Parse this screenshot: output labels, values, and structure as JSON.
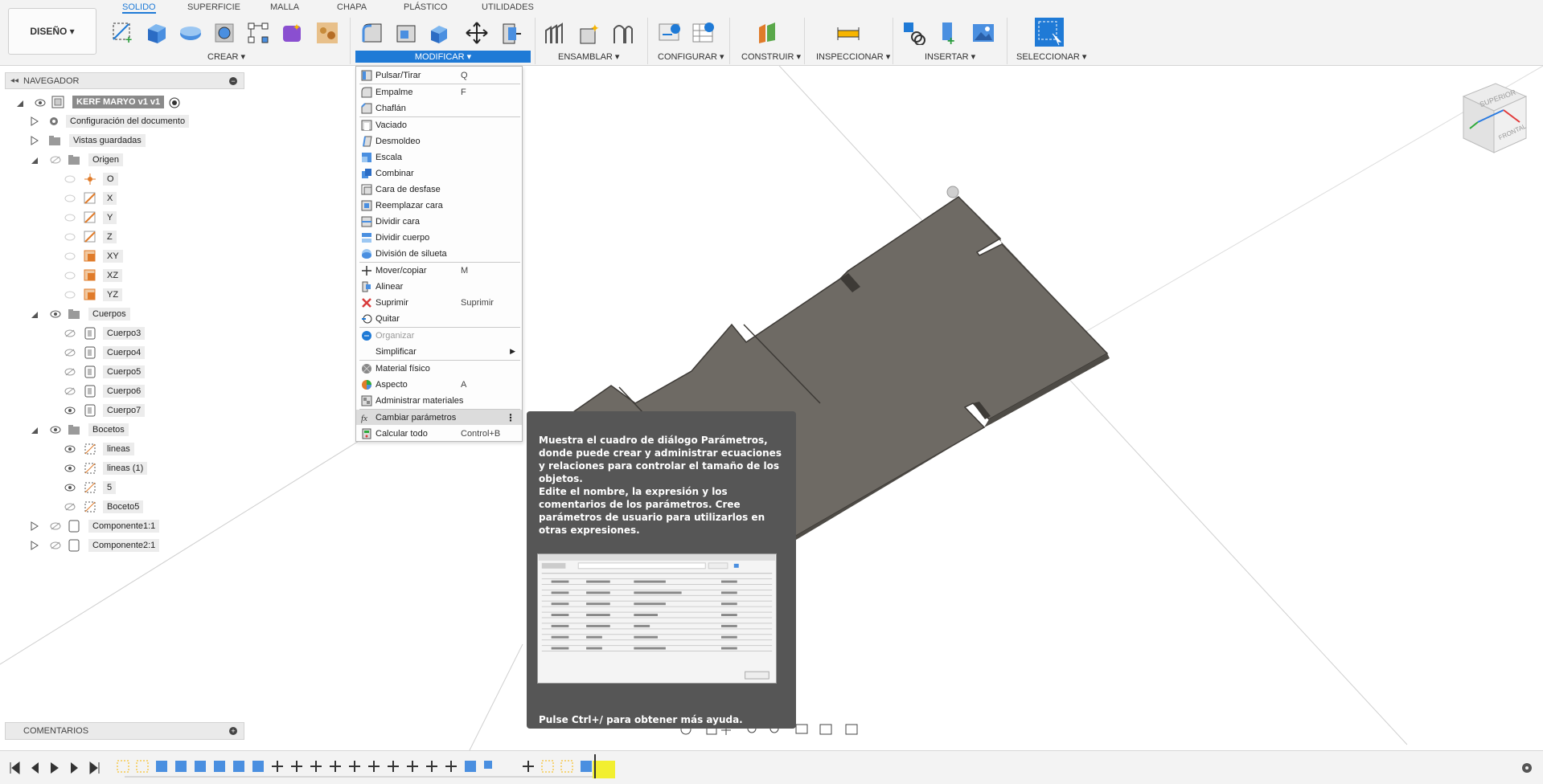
{
  "toolbar": {
    "design_label": "DISEÑO ▾",
    "tabs": [
      "SOLIDO",
      "SUPERFICIE",
      "MALLA",
      "CHAPA",
      "PLÁSTICO",
      "UTILIDADES"
    ],
    "groups": {
      "crear": "CREAR ▾",
      "modificar": "MODIFICAR ▾",
      "ensamblar": "ENSAMBLAR ▾",
      "configurar": "CONFIGURAR ▾",
      "construir": "CONSTRUIR ▾",
      "inspeccionar": "INSPECCIONAR ▾",
      "insertar": "INSERTAR ▾",
      "seleccionar": "SELECCIONAR ▾"
    },
    "accent": "#1f7ad6"
  },
  "navigator": {
    "title": "NAVEGADOR",
    "root": "KERF MARYO v1 v1",
    "items": {
      "doc_settings": "Configuración del documento",
      "saved_views": "Vistas guardadas",
      "origin": "Origen",
      "o": "O",
      "x": "X",
      "y": "Y",
      "z": "Z",
      "xy": "XY",
      "xz": "XZ",
      "yz": "YZ",
      "bodies": "Cuerpos",
      "body3": "Cuerpo3",
      "body4": "Cuerpo4",
      "body5": "Cuerpo5",
      "body6": "Cuerpo6",
      "body7": "Cuerpo7",
      "sketches": "Bocetos",
      "sk1": "lineas",
      "sk2": "lineas (1)",
      "sk3": "5",
      "sk4": "Boceto5",
      "comp1": "Componente1:1",
      "comp2": "Componente2:1"
    }
  },
  "comments": {
    "title": "COMENTARIOS"
  },
  "menu": {
    "items": [
      {
        "label": "Pulsar/Tirar",
        "key": "Q"
      },
      {
        "label": "Empalme",
        "key": "F"
      },
      {
        "label": "Chaflán",
        "key": ""
      },
      {
        "label": "Vaciado",
        "key": ""
      },
      {
        "label": "Desmoldeo",
        "key": ""
      },
      {
        "label": "Escala",
        "key": ""
      },
      {
        "label": "Combinar",
        "key": ""
      },
      {
        "label": "Cara de desfase",
        "key": ""
      },
      {
        "label": "Reemplazar cara",
        "key": ""
      },
      {
        "label": "Dividir cara",
        "key": ""
      },
      {
        "label": "Dividir cuerpo",
        "key": ""
      },
      {
        "label": "División de silueta",
        "key": ""
      },
      {
        "label": "Mover/copiar",
        "key": "M"
      },
      {
        "label": "Alinear",
        "key": ""
      },
      {
        "label": "Suprimir",
        "key": "Suprimir"
      },
      {
        "label": "Quitar",
        "key": ""
      },
      {
        "label": "Organizar",
        "key": ""
      },
      {
        "label": "Simplificar",
        "key": ""
      },
      {
        "label": "Material físico",
        "key": ""
      },
      {
        "label": "Aspecto",
        "key": "A"
      },
      {
        "label": "Administrar materiales",
        "key": ""
      },
      {
        "label": "Cambiar parámetros",
        "key": ""
      },
      {
        "label": "Calcular todo",
        "key": "Control+B"
      }
    ]
  },
  "tooltip": {
    "para1": "Muestra el cuadro de diálogo Parámetros, donde puede crear y administrar ecuaciones y relaciones para controlar el tamaño de los objetos.",
    "para2": "Edite el nombre, la expresión y los comentarios de los parámetros. Cree parámetros de usuario para utilizarlos en otras expresiones.",
    "help": "Pulse Ctrl+/ para obtener más ayuda."
  },
  "viewcube": {
    "top": "SUPERIOR",
    "front": "FRONTAL"
  }
}
